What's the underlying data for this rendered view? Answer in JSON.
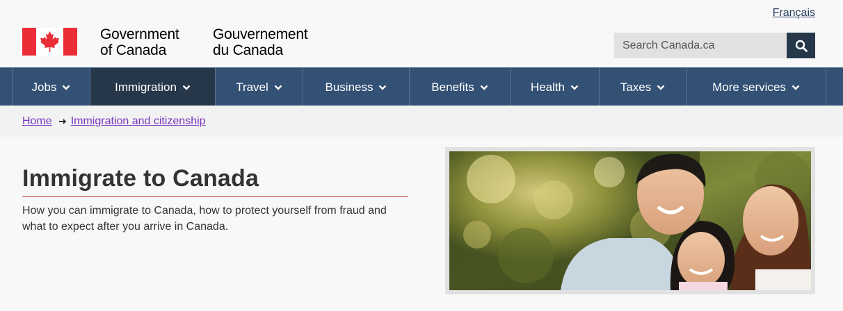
{
  "header": {
    "language_toggle": "Français",
    "fip": {
      "en_line1": "Government",
      "en_line2": "of Canada",
      "fr_line1": "Gouvernement",
      "fr_line2": "du Canada",
      "flag_icon": "canada-flag-icon"
    },
    "search": {
      "placeholder": "Search Canada.ca",
      "button_icon": "search-icon"
    }
  },
  "menu": {
    "items": [
      {
        "label": "Jobs"
      },
      {
        "label": "Immigration",
        "active": true
      },
      {
        "label": "Travel"
      },
      {
        "label": "Business"
      },
      {
        "label": "Benefits"
      },
      {
        "label": "Health"
      },
      {
        "label": "Taxes"
      },
      {
        "label": "More services"
      }
    ]
  },
  "breadcrumb": {
    "items": [
      "Home",
      "Immigration and citizenship"
    ]
  },
  "main": {
    "title": "Immigrate to Canada",
    "intro": "How you can immigrate to Canada, how to protect yourself from fraud and what to expect after you arrive in Canada."
  },
  "colors": {
    "menu_bg": "#335075",
    "menu_active": "#26374a",
    "link": "#284162",
    "visited_link": "#7834bc",
    "title_rule": "#af3c43",
    "flag_red": "#eb2d37"
  }
}
